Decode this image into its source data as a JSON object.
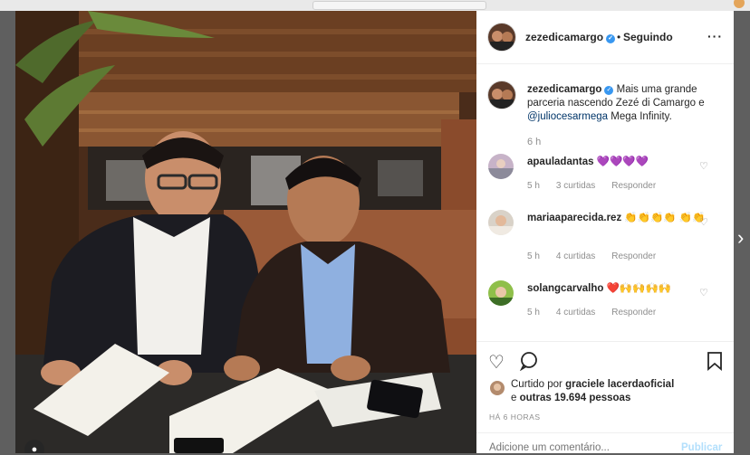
{
  "post": {
    "username": "zezedicamargo",
    "separator": "•",
    "follow_status": "Seguindo",
    "more_icon": "more-options-icon",
    "caption_text": "Mais uma grande parceria nascendo Zezé di Camargo e",
    "caption_mention": "@juliocesarmega",
    "caption_tail": "Mega Infinity.",
    "caption_time": "6 h"
  },
  "comments": [
    {
      "username": "apauladantas",
      "text": "💜💜💜💜",
      "time": "5 h",
      "likes": "3 curtidas",
      "reply": "Responder"
    },
    {
      "username": "mariaaparecida.rez",
      "text": "👏👏👏👏 👏👏",
      "time": "5 h",
      "likes": "4 curtidas",
      "reply": "Responder"
    },
    {
      "username": "solangcarvalho",
      "text": "❤️🙌🙌🙌🙌",
      "time": "5 h",
      "likes": "4 curtidas",
      "reply": "Responder"
    }
  ],
  "actions": {
    "liked_prefix": "Curtido por",
    "liked_user": "graciele lacerdaoficial",
    "liked_and": "e",
    "liked_others": "outras 19.694 pessoas",
    "post_time": "HÁ 6 HORAS"
  },
  "comment_form": {
    "placeholder": "Adicione um comentário...",
    "submit_label": "Publicar"
  },
  "colors": {
    "accent": "#3897f0",
    "link": "#003569",
    "muted": "#8e8e8e",
    "publish_disabled": "#b2dffc"
  }
}
